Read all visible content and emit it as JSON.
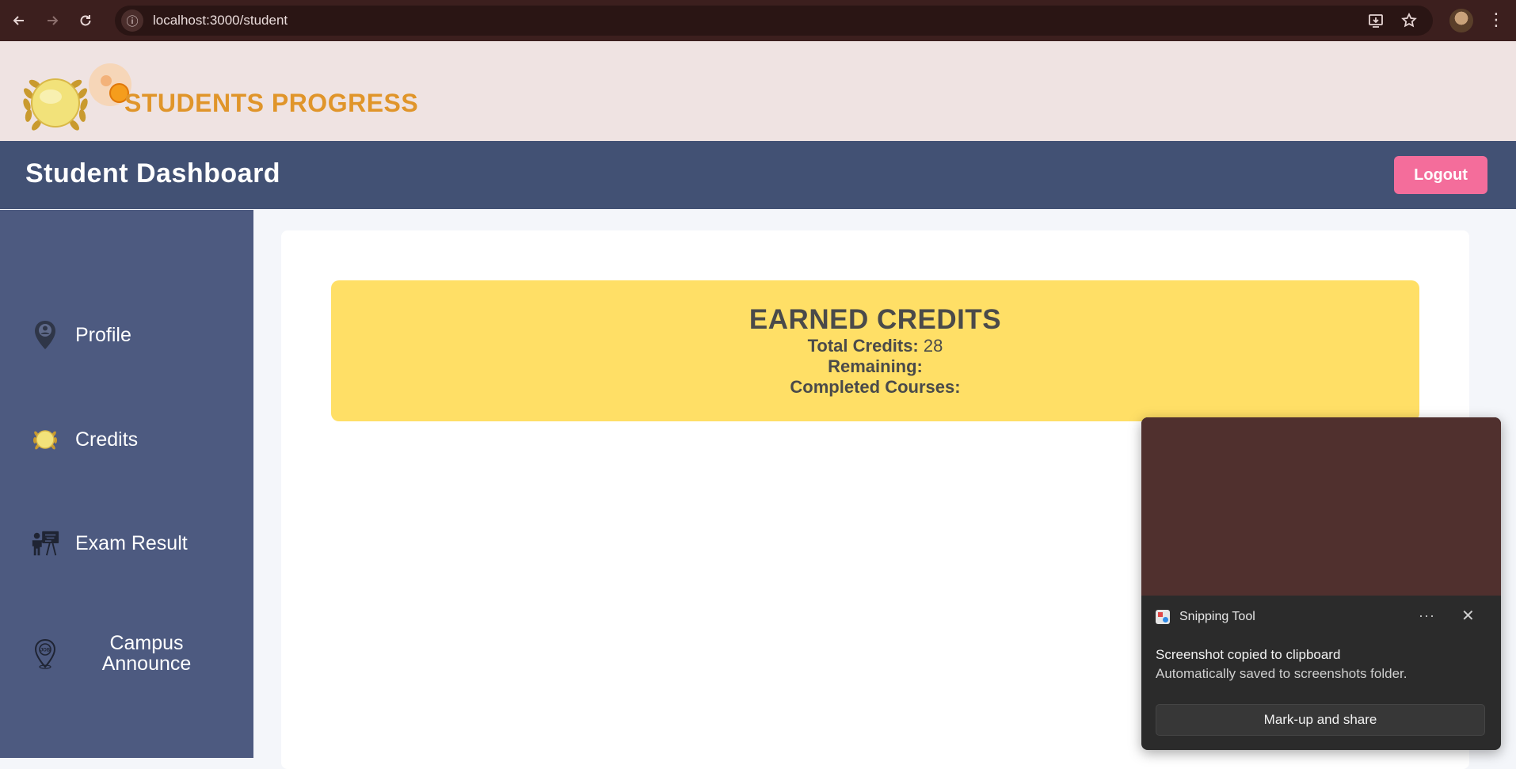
{
  "browser": {
    "url": "localhost:3000/student",
    "back_icon": "arrow-left-icon",
    "forward_icon": "arrow-right-icon",
    "reload_icon": "reload-icon",
    "kebab_label": "⋮"
  },
  "site": {
    "brand_title": "STUDENTS PROGRESS"
  },
  "dashboard": {
    "title": "Student Dashboard",
    "logout_label": "Logout"
  },
  "sidebar": {
    "items": [
      {
        "label": "Profile",
        "icon": "profile-pin-icon"
      },
      {
        "label": "Credits",
        "icon": "laurel-medal-icon"
      },
      {
        "label": "Exam Result",
        "icon": "teacher-board-icon"
      },
      {
        "label_line1": "Campus",
        "label_line2": "Announce",
        "icon": "job-location-icon"
      }
    ]
  },
  "credits": {
    "title": "EARNED CREDITS",
    "total_label": "Total Credits:",
    "total_value": "28",
    "remaining_label": "Remaining:",
    "remaining_value": "",
    "completed_label": "Completed Courses:",
    "completed_value": ""
  },
  "toast": {
    "app_name": "Snipping Tool",
    "more_label": "···",
    "close_label": "✕",
    "message": "Screenshot copied to clipboard",
    "sub_message": "Automatically saved to screenshots folder.",
    "action_label": "Mark-up and share"
  },
  "colors": {
    "browser_bg": "#3c1f1e",
    "header_bg": "#efe3e2",
    "brand": "#e0952a",
    "dash_bar": "#425174",
    "sidebar": "#4d5a80",
    "logout": "#f46d9b",
    "credits_box": "#ffdf66"
  }
}
